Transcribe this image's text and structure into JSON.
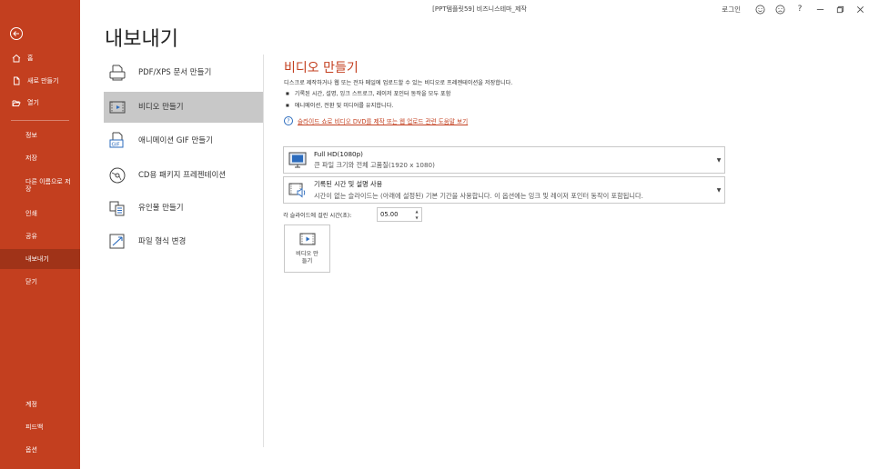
{
  "window": {
    "doc_title": "[PPT템플릿59] 비즈니스테마_제작",
    "login": "로그인",
    "help": "?"
  },
  "nav": {
    "home": "홈",
    "new": "새로 만들기",
    "open": "열기",
    "info": "정보",
    "save": "저장",
    "save_as": "다른 이름으로 저장",
    "print": "인쇄",
    "share": "공유",
    "export": "내보내기",
    "close": "닫기",
    "account": "계정",
    "feedback": "피드백",
    "options": "옵션"
  },
  "page": {
    "title": "내보내기"
  },
  "export_options": [
    {
      "label": "PDF/XPS 문서 만들기"
    },
    {
      "label": "비디오 만들기"
    },
    {
      "label": "애니메이션 GIF 만들기"
    },
    {
      "label": "CD용 패키지 프레젠테이션"
    },
    {
      "label": "유인물 만들기"
    },
    {
      "label": "파일 형식 변경"
    }
  ],
  "video": {
    "title": "비디오 만들기",
    "description": "디스크로 제작하거나 웹 또는 전자 메일에 업로드할 수 있는 비디오로 프레젠테이션을 저장합니다.",
    "bullets": [
      "기록된 시간, 설명, 잉크 스트로크, 레이저 포인터 동작을 모두 포함",
      "애니메이션, 전환 및 미디어를 유지합니다."
    ],
    "help_link": "슬라이드 쇼로 비디오 DVD를 제작 또는 웹 업로드 관련 도움말 보기",
    "quality": {
      "main": "Full HD(1080p)",
      "sub": "큰 파일 크기와 전체 고품질(1920 x 1080)"
    },
    "timing": {
      "main": "기록된 시간 및 설명 사용",
      "sub": "시간이 없는 슬라이드는 (아래에 설정된) 기본 기간을 사용합니다. 이 옵션에는 잉크 및 레이저 포인터 동작이 포함됩니다."
    },
    "seconds_label": "각 슬라이드에 걸린 시간(초):",
    "seconds_value": "05.00",
    "create_button": "비디오 만들기"
  }
}
